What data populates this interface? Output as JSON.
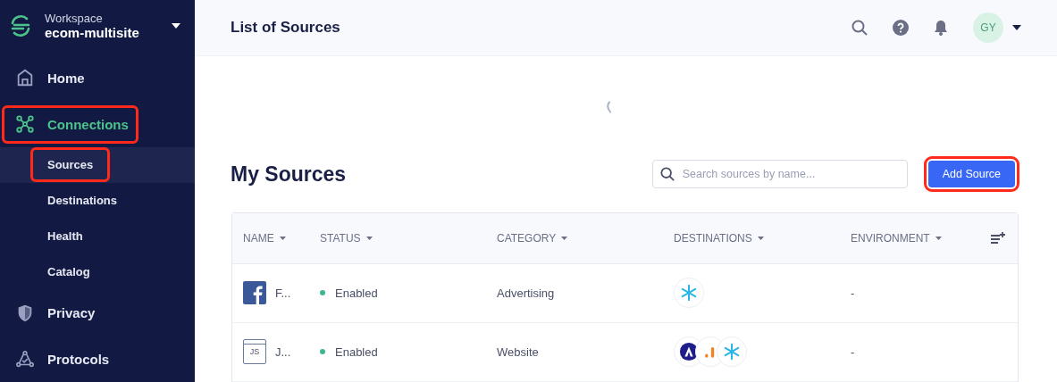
{
  "workspace": {
    "label": "Workspace",
    "name": "ecom-multisite"
  },
  "sidebar": {
    "items": [
      {
        "label": "Home",
        "kind": "home",
        "selected": false,
        "highlighted": false
      },
      {
        "label": "Connections",
        "kind": "connections",
        "selected": true,
        "highlighted": true,
        "children": [
          {
            "label": "Sources",
            "selected": true,
            "highlighted": true
          },
          {
            "label": "Destinations",
            "selected": false,
            "highlighted": false
          },
          {
            "label": "Health",
            "selected": false,
            "highlighted": false
          },
          {
            "label": "Catalog",
            "selected": false,
            "highlighted": false
          }
        ]
      },
      {
        "label": "Privacy",
        "kind": "privacy",
        "selected": false,
        "highlighted": false
      },
      {
        "label": "Protocols",
        "kind": "protocols",
        "selected": false,
        "highlighted": false
      }
    ]
  },
  "header": {
    "title": "List of Sources",
    "avatar": "GY"
  },
  "section": {
    "title": "My Sources",
    "search": {
      "placeholder": "Search sources by name..."
    },
    "add_button": {
      "label": "Add Source",
      "highlighted": true
    }
  },
  "table": {
    "columns": [
      "NAME",
      "STATUS",
      "CATEGORY",
      "DESTINATIONS",
      "ENVIRONMENT"
    ],
    "rows": [
      {
        "kind": "facebook",
        "name": "F...",
        "status": {
          "label": "Enabled",
          "color": "#3fb68b"
        },
        "category": "Advertising",
        "destinations": [
          {
            "kind": "snowflake"
          }
        ],
        "environment": "-"
      },
      {
        "kind": "javascript",
        "icon_text": "JS",
        "name": "J...",
        "status": {
          "label": "Enabled",
          "color": "#3fb68b"
        },
        "category": "Website",
        "destinations": [
          {
            "kind": "circle"
          },
          {
            "kind": "bars"
          },
          {
            "kind": "snowflake"
          }
        ],
        "environment": "-"
      }
    ]
  }
}
